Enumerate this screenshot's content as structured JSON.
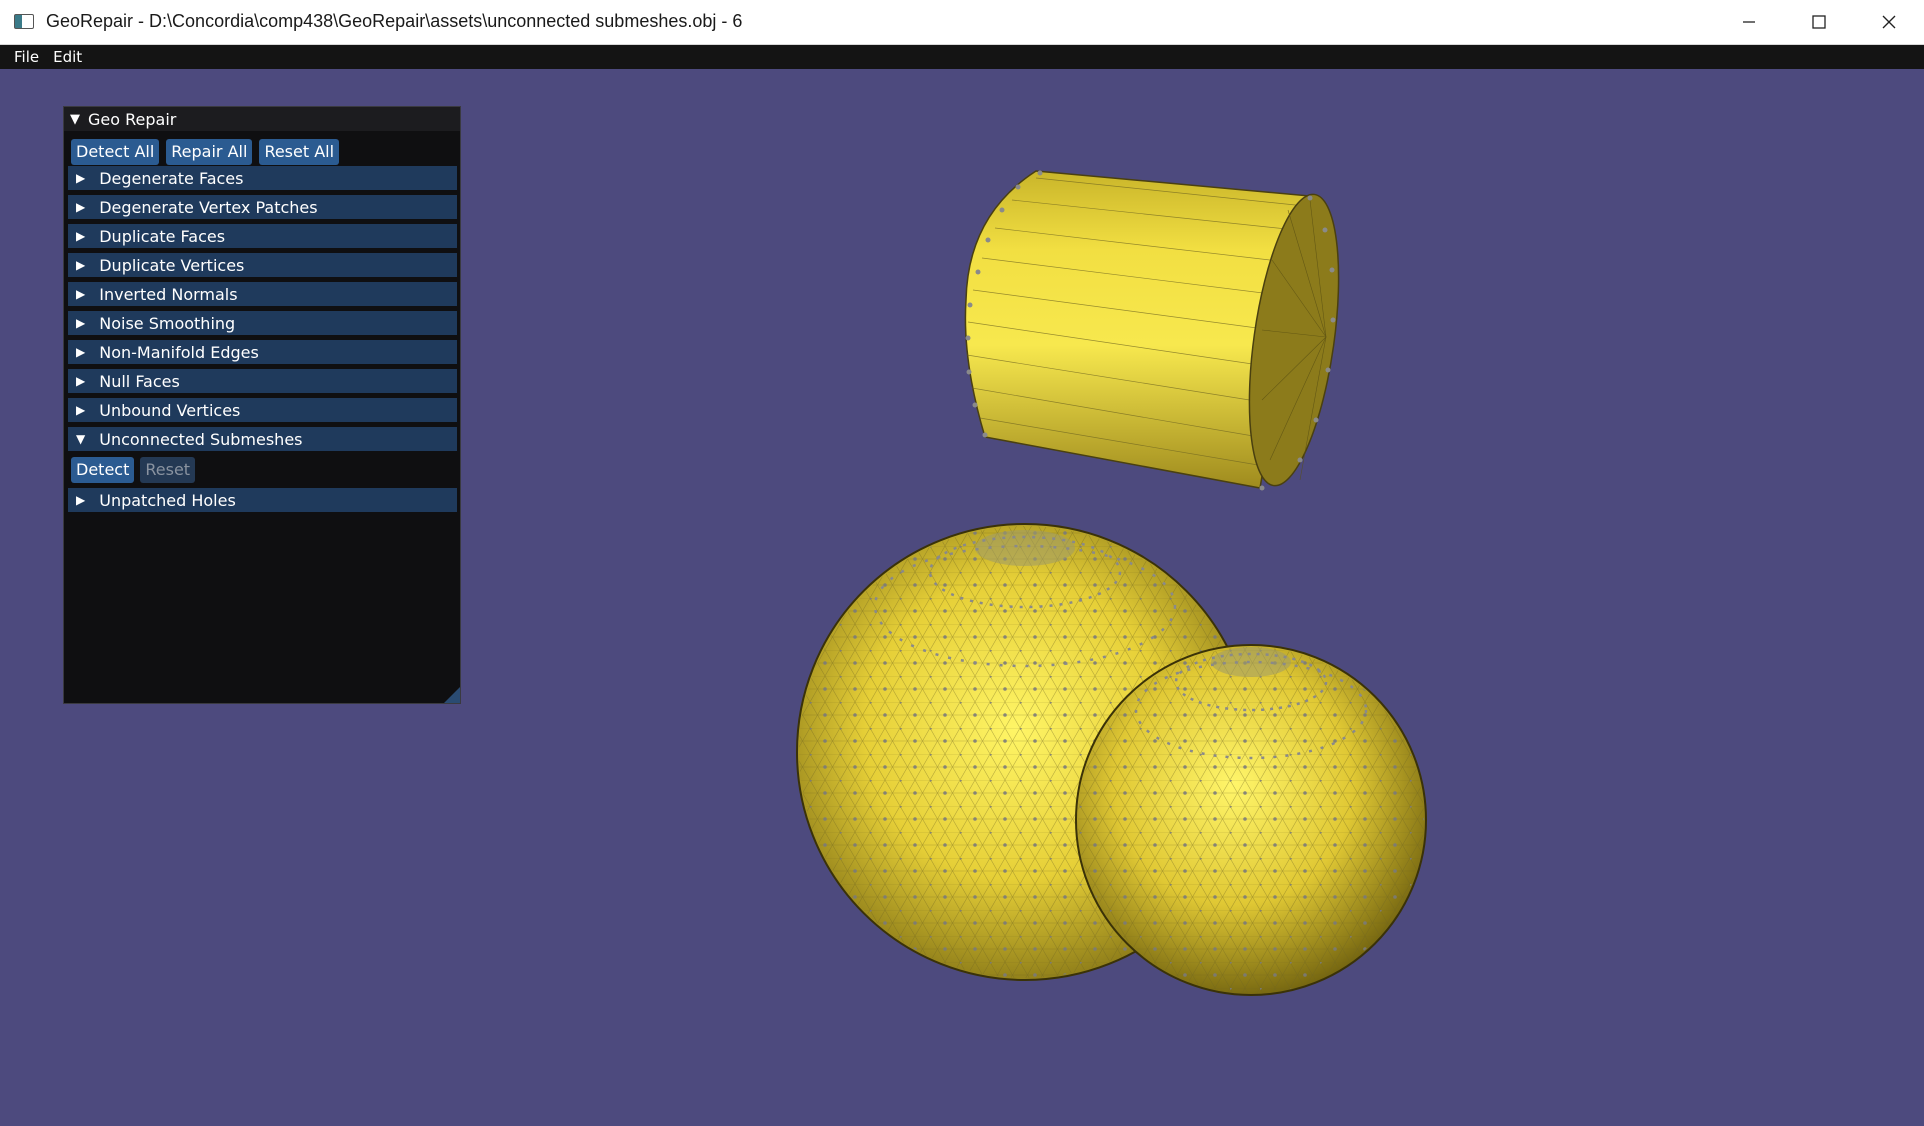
{
  "window": {
    "title": "GeoRepair - D:\\Concordia\\comp438\\GeoRepair\\assets\\unconnected submeshes.obj - 6",
    "controls": [
      "minimize-icon",
      "maximize-icon",
      "close-icon"
    ]
  },
  "menu": {
    "file": "File",
    "edit": "Edit"
  },
  "panel": {
    "title": "Geo Repair",
    "buttons": {
      "detect_all": "Detect All",
      "repair_all": "Repair All",
      "reset_all": "Reset All"
    },
    "sections": [
      "Degenerate Faces",
      "Degenerate Vertex Patches",
      "Duplicate Faces",
      "Duplicate Vertices",
      "Inverted Normals",
      "Noise Smoothing",
      "Non-Manifold Edges",
      "Null Faces",
      "Unbound Vertices",
      "Unconnected Submeshes",
      "Unpatched Holes"
    ],
    "expanded_section": {
      "detect": "Detect",
      "reset": "Reset"
    }
  },
  "colors": {
    "viewport_bg": "#4d4a7e",
    "mesh_fill": "#f2e03a",
    "button_active": "#2b5b91",
    "section_bg": "#1f3a5c"
  }
}
